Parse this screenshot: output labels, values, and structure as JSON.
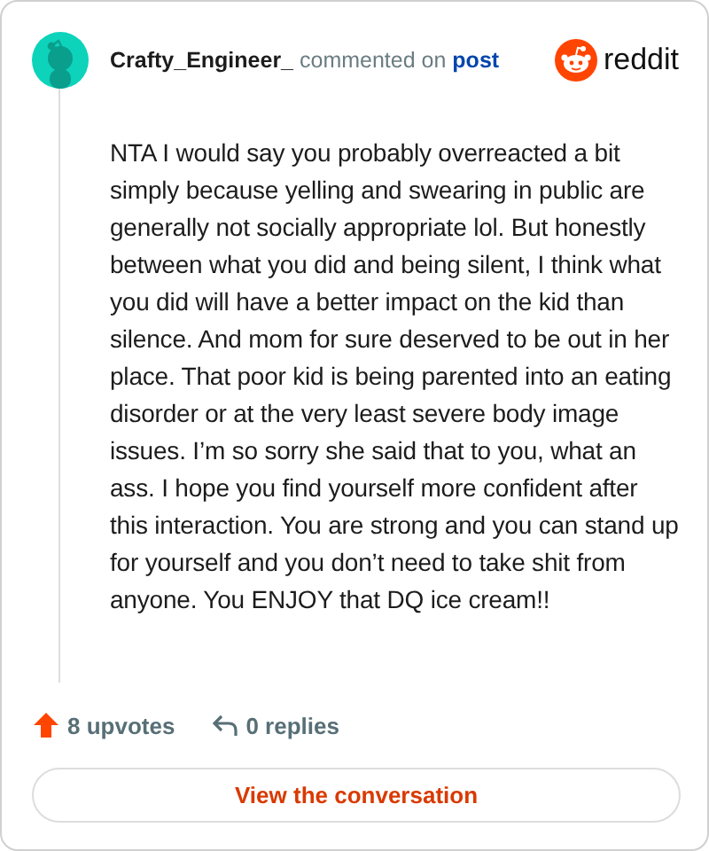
{
  "author": "Crafty_Engineer_",
  "action": "commented on",
  "post_link": "post",
  "brand": "reddit",
  "body": "NTA I would say you probably overreacted a bit simply because yelling and swearing in public are generally not socially appropriate lol. But honestly between what you did and being silent, I think what you did will have a better impact on the kid than silence. And mom for sure deserved to be out in her place. That poor kid is being parented into an eating disorder or at the very least severe body image issues. I’m so sorry she said that to you, what an ass. I hope you find yourself more confident after this interaction. You are strong and you can stand up for yourself and you don’t need to take shit from anyone. You ENJOY that DQ ice cream!!",
  "upvotes": "8 upvotes",
  "replies": "0 replies",
  "button": "View the conversation"
}
